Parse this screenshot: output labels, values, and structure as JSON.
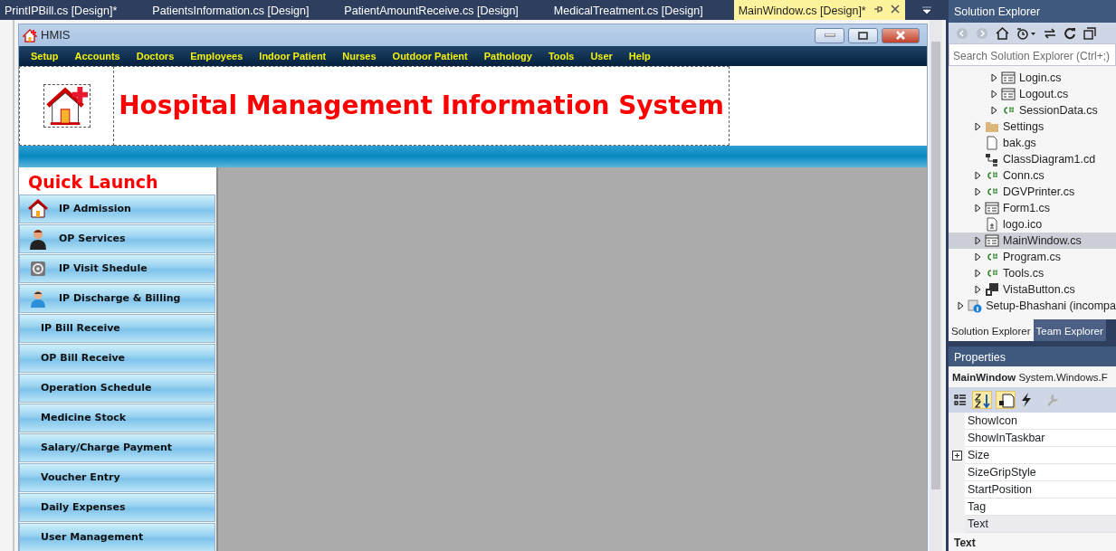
{
  "document_tabs": [
    {
      "label": "PrintIPBill.cs [Design]*",
      "selected": false
    },
    {
      "label": "PatientsInformation.cs [Design]",
      "selected": false
    },
    {
      "label": "PatientAmountReceive.cs [Design]",
      "selected": false
    },
    {
      "label": "MedicalTreatment.cs [Design]",
      "selected": false
    },
    {
      "label": "MainWindow.cs [Design]*",
      "selected": true
    }
  ],
  "form": {
    "title": "HMIS",
    "menu": [
      "Setup",
      "Accounts",
      "Doctors",
      "Employees",
      "Indoor Patient",
      "Nurses",
      "Outdoor Patient",
      "Pathology",
      "Tools",
      "User",
      "Help"
    ],
    "header_title": "Hospital Management Information System",
    "quick_launch_title": "Quick Launch",
    "quick_launch": [
      {
        "label": "IP Admission",
        "kind": "home"
      },
      {
        "label": "OP Services",
        "kind": "person"
      },
      {
        "label": "IP Visit Shedule",
        "kind": "gear"
      },
      {
        "label": "IP Discharge & Billing",
        "kind": "user"
      },
      {
        "label": "IP Bill Receive",
        "kind": "plain"
      },
      {
        "label": "OP Bill Receive",
        "kind": "plain"
      },
      {
        "label": "Operation Schedule",
        "kind": "plain"
      },
      {
        "label": "Medicine Stock",
        "kind": "plain"
      },
      {
        "label": "Salary/Charge Payment",
        "kind": "plain"
      },
      {
        "label": "Voucher Entry",
        "kind": "plain"
      },
      {
        "label": "Daily Expenses",
        "kind": "plain"
      },
      {
        "label": "User Management",
        "kind": "plain"
      }
    ]
  },
  "solution_explorer": {
    "title": "Solution Explorer",
    "search": {
      "placeholder": "Search Solution Explorer (Ctrl+;)"
    },
    "tree": [
      {
        "children": [
          {
            "children": [
              {
                "label": "Login.cs",
                "kind": "form",
                "expandable": true,
                "selected": false
              },
              {
                "label": "Logout.cs",
                "kind": "form",
                "expandable": true,
                "selected": false
              },
              {
                "label": "SessionData.cs",
                "kind": "csharp",
                "expandable": true,
                "selected": false
              }
            ]
          },
          {
            "label": "Settings",
            "kind": "folder",
            "expandable": true,
            "selected": false
          },
          {
            "label": "bak.gs",
            "kind": "file",
            "expandable": false,
            "selected": false
          },
          {
            "label": "ClassDiagram1.cd",
            "kind": "diagram",
            "expandable": false,
            "selected": false
          },
          {
            "label": "Conn.cs",
            "kind": "csharp",
            "expandable": true,
            "selected": false
          },
          {
            "label": "DGVPrinter.cs",
            "kind": "csharp",
            "expandable": true,
            "selected": false
          },
          {
            "label": "Form1.cs",
            "kind": "form",
            "expandable": true,
            "selected": false
          },
          {
            "label": "logo.ico",
            "kind": "icon",
            "expandable": false,
            "selected": false
          },
          {
            "label": "MainWindow.cs",
            "kind": "form",
            "expandable": true,
            "selected": true
          },
          {
            "label": "Program.cs",
            "kind": "csharp",
            "expandable": true,
            "selected": false
          },
          {
            "label": "Tools.cs",
            "kind": "csharp",
            "expandable": true,
            "selected": false
          },
          {
            "label": "VistaButton.cs",
            "kind": "component",
            "expandable": true,
            "selected": false
          }
        ]
      },
      {
        "label": "Setup-Bhashani (incompa",
        "kind": "project",
        "expandable": true,
        "selected": false
      }
    ],
    "tabs": [
      {
        "label": "Solution Explorer",
        "selected": true
      },
      {
        "label": "Team Explorer",
        "selected": false
      }
    ]
  },
  "properties": {
    "title": "Properties",
    "object_name": "MainWindow",
    "object_type": "System.Windows.F",
    "rows": [
      {
        "name": "ShowIcon",
        "expandable": false,
        "selected": false
      },
      {
        "name": "ShowInTaskbar",
        "expandable": false,
        "selected": false
      },
      {
        "name": "Size",
        "expandable": true,
        "selected": false
      },
      {
        "name": "SizeGripStyle",
        "expandable": false,
        "selected": false
      },
      {
        "name": "StartPosition",
        "expandable": false,
        "selected": false
      },
      {
        "name": "Tag",
        "expandable": false,
        "selected": false
      },
      {
        "name": "Text",
        "expandable": false,
        "selected": true
      }
    ],
    "description_title": "Text"
  }
}
